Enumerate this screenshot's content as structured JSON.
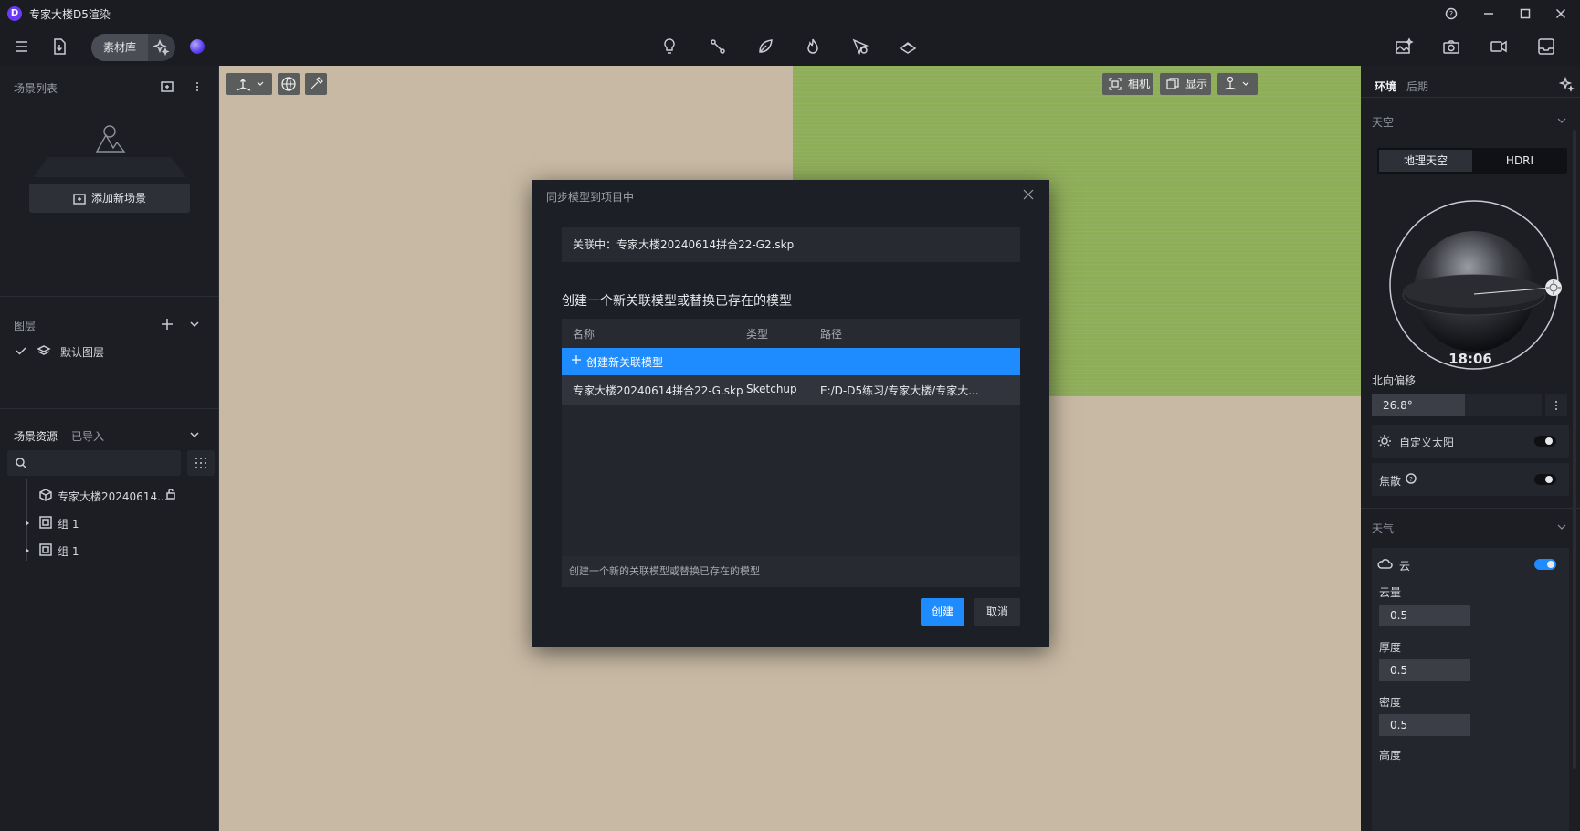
{
  "window": {
    "title": "专家大楼D5渲染",
    "logo_letter": "D"
  },
  "toolbar": {
    "asset_library_label": "素材库"
  },
  "left_panel": {
    "scene_list_title": "场景列表",
    "add_scene_label": "添加新场景",
    "layers_title": "图层",
    "default_layer_label": "默认图层",
    "scene_assets_tab": "场景资源",
    "imported_tab": "已导入",
    "tree": [
      {
        "label": "专家大楼20240614..."
      },
      {
        "label": "组 1"
      },
      {
        "label": "组 1"
      }
    ]
  },
  "viewport": {
    "camera_label": "相机",
    "display_label": "显示"
  },
  "dialog": {
    "title": "同步模型到项目中",
    "linked_text": "关联中：专家大楼20240614拼合22-G2.skp",
    "heading": "创建一个新关联模型或替换已存在的模型",
    "columns": {
      "name": "名称",
      "type": "类型",
      "path": "路径"
    },
    "new_row_label": "创建新关联模型",
    "file_row": {
      "name": "专家大楼20240614拼合22-G.skp",
      "type": "Sketchup",
      "path": "E:/D-D5练习/专家大楼/专家大..."
    },
    "hint": "创建一个新的关联模型或替换已存在的模型",
    "create_label": "创建",
    "cancel_label": "取消"
  },
  "right_panel": {
    "tab_environment": "环境",
    "tab_post": "后期",
    "sky_section": "天空",
    "sky_tab_geo": "地理天空",
    "sky_tab_hdri": "HDRI",
    "time": "18:06",
    "north_offset_label": "北向偏移",
    "north_offset_value": "26.8°",
    "north_offset_fraction": 0.5,
    "custom_sun_label": "自定义太阳",
    "custom_sun_on": false,
    "caustics_label": "焦散",
    "caustics_on": false,
    "weather_section": "天气",
    "cloud_label": "云",
    "cloud_on": true,
    "cloud_amount_label": "云量",
    "cloud_amount_value": "0.5",
    "cloud_amount_fraction": 0.5,
    "thickness_label": "厚度",
    "thickness_value": "0.5",
    "thickness_fraction": 0.5,
    "density_label": "密度",
    "density_value": "0.5",
    "density_fraction": 0.5,
    "height_label": "高度"
  }
}
